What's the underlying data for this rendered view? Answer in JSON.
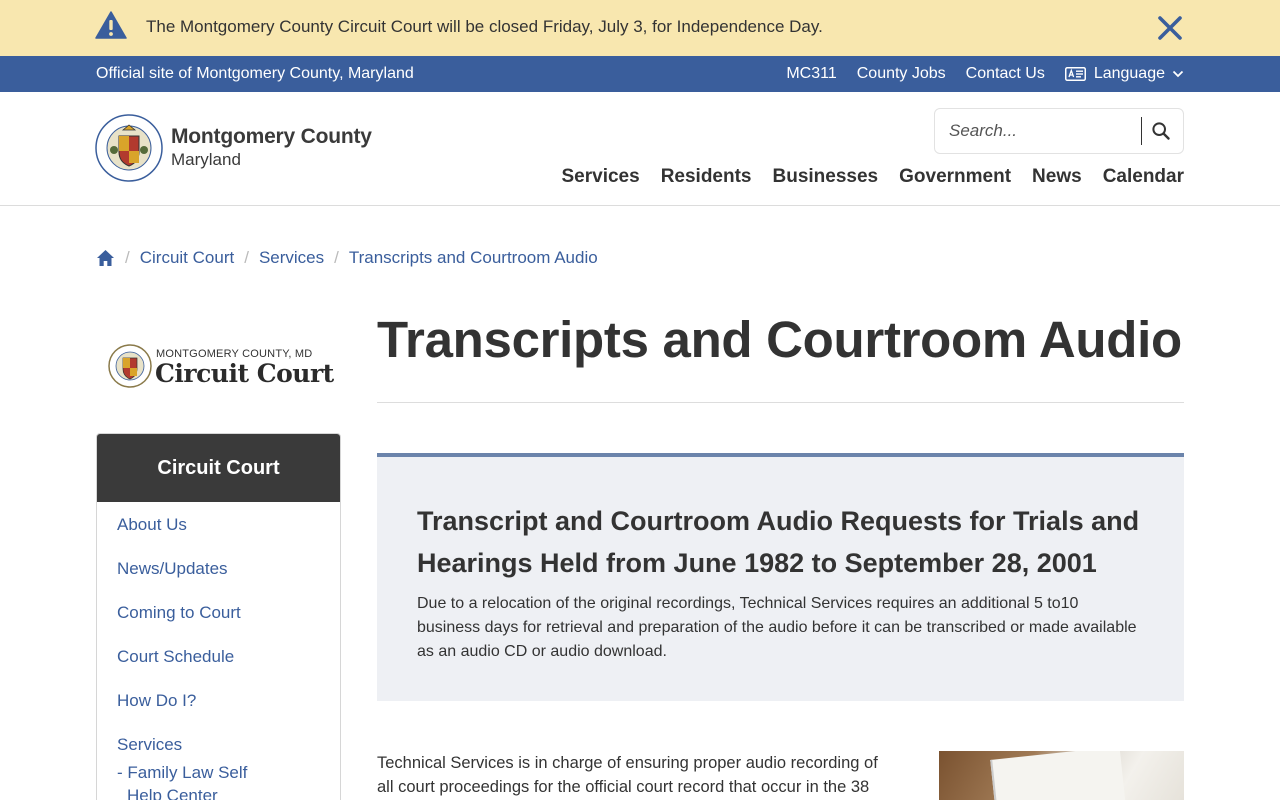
{
  "alert": {
    "message": "The Montgomery County Circuit Court will be closed Friday, July 3, for Independence Day.",
    "icon": "warning-icon",
    "close_icon": "close-icon",
    "color": "#f8e7af"
  },
  "utility_bar": {
    "official": "Official site of Montgomery County, Maryland",
    "links": [
      "MC311",
      "County Jobs",
      "Contact Us"
    ],
    "language": "Language",
    "color": "#3a5e9c"
  },
  "header": {
    "brand_name": "Montgomery County",
    "brand_sub": "Maryland",
    "search_placeholder": "Search...",
    "nav": [
      "Services",
      "Residents",
      "Businesses",
      "Government",
      "News",
      "Calendar"
    ]
  },
  "breadcrumb": [
    "Circuit Court",
    "Services",
    "Transcripts and Courtroom Audio"
  ],
  "sidebar": {
    "logo_small": "MONTGOMERY COUNTY, MD",
    "logo_big": "Circuit Court",
    "heading": "Circuit Court",
    "items": [
      "About Us",
      "News/Updates",
      "Coming to Court",
      "Court Schedule",
      "How Do I?",
      "Services"
    ],
    "sub_items": [
      "- Family Law Self Help Center"
    ]
  },
  "main": {
    "title": "Transcripts and Courtroom Audio",
    "callout_title": "Transcript and Courtroom Audio Requests for Trials and Hearings Held from June 1982 to September 28, 2001",
    "callout_body": "Due to a relocation of the original recordings, Technical Services requires an additional 5 to10 business days for retrieval and preparation of the audio before it can be transcribed or made available as an audio CD or audio download.",
    "body": "Technical Services is in charge of ensuring proper audio recording of all court proceedings for the official court record that occur in the 38"
  }
}
